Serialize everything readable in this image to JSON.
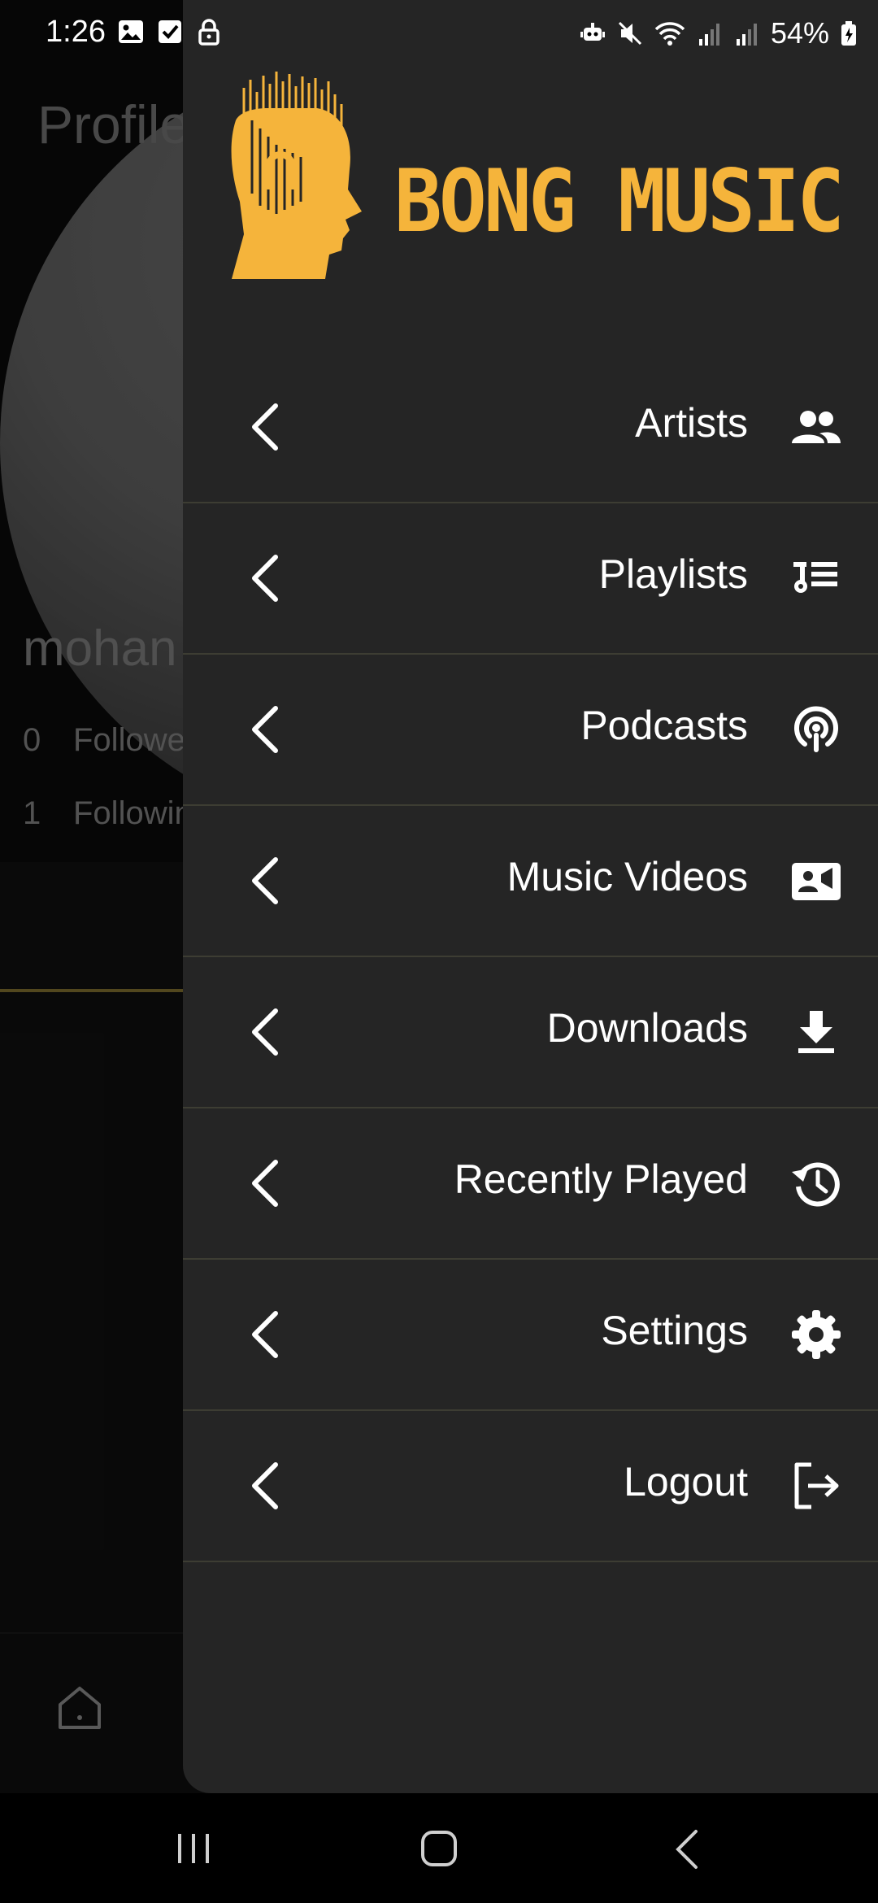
{
  "status_bar": {
    "time": "1:26",
    "battery": "54%",
    "left_icons": [
      "image-icon",
      "checkbox-icon",
      "lock-icon"
    ],
    "right_icons": [
      "robot-icon",
      "mute-icon",
      "wifi-icon",
      "signal-icon",
      "signal-icon",
      "battery-charging-icon"
    ]
  },
  "background_page": {
    "title": "Profile",
    "username": "mohan",
    "stats": [
      {
        "count": "0",
        "label": "Followers"
      },
      {
        "count": "1",
        "label": "Following"
      }
    ]
  },
  "drawer": {
    "brand_name": "BONG MUSIC",
    "accent_color": "#f5b43b",
    "menu": [
      {
        "label": "Artists",
        "icon": "people-icon"
      },
      {
        "label": "Playlists",
        "icon": "playlist-icon"
      },
      {
        "label": "Podcasts",
        "icon": "podcast-icon"
      },
      {
        "label": "Music Videos",
        "icon": "video-camera-icon"
      },
      {
        "label": "Downloads",
        "icon": "download-icon"
      },
      {
        "label": "Recently Played",
        "icon": "history-icon"
      },
      {
        "label": "Settings",
        "icon": "gear-icon"
      },
      {
        "label": "Logout",
        "icon": "logout-icon"
      }
    ]
  },
  "nav_bar": {
    "buttons": [
      "recent-apps",
      "home",
      "back"
    ]
  }
}
